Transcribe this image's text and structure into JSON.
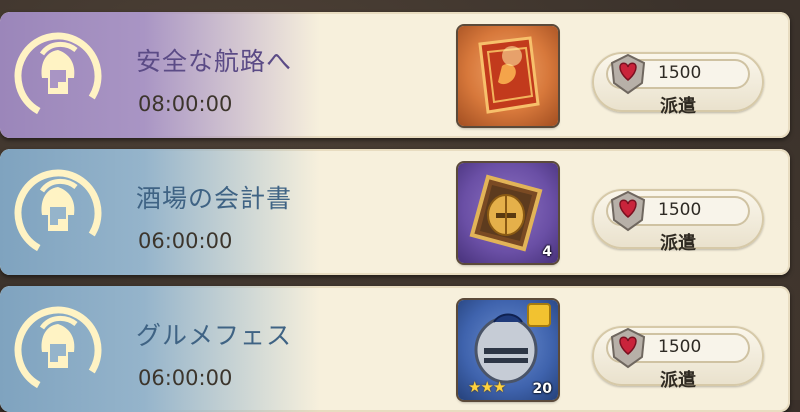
{
  "missions": [
    {
      "title": "安全な航路へ",
      "time": "08:00:00",
      "theme": "purple",
      "item": {
        "icon": "scroll-map-icon",
        "count": "",
        "stars": ""
      },
      "cost": "1500",
      "action_label": "派遣"
    },
    {
      "title": "酒場の会計書",
      "time": "06:00:00",
      "theme": "blue",
      "item": {
        "icon": "knight-helmet-card-icon",
        "count": "4",
        "stars": ""
      },
      "cost": "1500",
      "action_label": "派遣"
    },
    {
      "title": "グルメフェス",
      "time": "06:00:00",
      "theme": "blue",
      "item": {
        "icon": "armor-helmet-icon",
        "count": "20",
        "stars": "★★★"
      },
      "cost": "1500",
      "action_label": "派遣"
    }
  ],
  "colors": {
    "purple_band": "#9b86ba",
    "blue_band": "#7fa3bf",
    "card_bg": "#f7f0dc",
    "gem": "#c9243b"
  }
}
